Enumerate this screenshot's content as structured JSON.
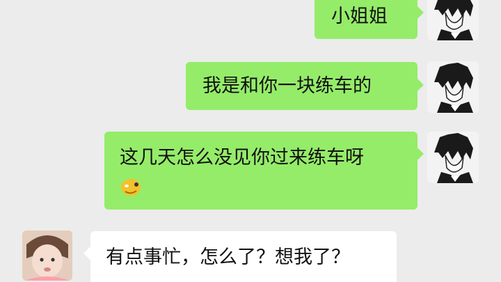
{
  "messages": [
    {
      "side": "outgoing",
      "sender_avatar": "boy-anime-avatar",
      "text": "小姐姐"
    },
    {
      "side": "outgoing",
      "sender_avatar": "boy-anime-avatar",
      "text": "我是和你一块练车的"
    },
    {
      "side": "outgoing",
      "sender_avatar": "boy-anime-avatar",
      "text": "这几天怎么没见你过来练车呀",
      "emoji": "face-emoji"
    },
    {
      "side": "incoming",
      "sender_avatar": "girl-photo-avatar",
      "text": "有点事忙，怎么了？想我了？"
    }
  ],
  "colors": {
    "background": "#ececec",
    "outgoing_bubble": "#95ec69",
    "incoming_bubble": "#ffffff"
  }
}
